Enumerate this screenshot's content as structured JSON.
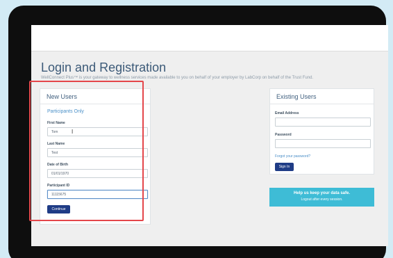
{
  "page": {
    "title": "Login and Registration",
    "subtitle": "WellConnect Plus™ is your gateway to wellness services made available to you on behalf of your employer by LabCorp on behalf of the Trust Fund."
  },
  "new_users": {
    "heading": "New Users",
    "section": "Participants Only",
    "first_name_label": "First Name",
    "first_name_value": "Tom",
    "last_name_label": "Last Name",
    "last_name_value": "Test",
    "dob_label": "Date of Birth",
    "dob_value": "01/01/1970",
    "participant_id_label": "Participant ID",
    "participant_id_value": "11115675",
    "continue_label": "Continue"
  },
  "existing_users": {
    "heading": "Existing Users",
    "email_label": "Email Address",
    "email_value": "",
    "password_label": "Password",
    "password_value": "",
    "forgot_label": "Forgot your password?",
    "sign_in_label": "Sign In"
  },
  "info": {
    "title": "Help us keep your data safe.",
    "subtitle": "Logout after every session."
  },
  "colors": {
    "accent": "#1f3c86",
    "info": "#3ebcd6",
    "highlight": "#e4464a"
  }
}
